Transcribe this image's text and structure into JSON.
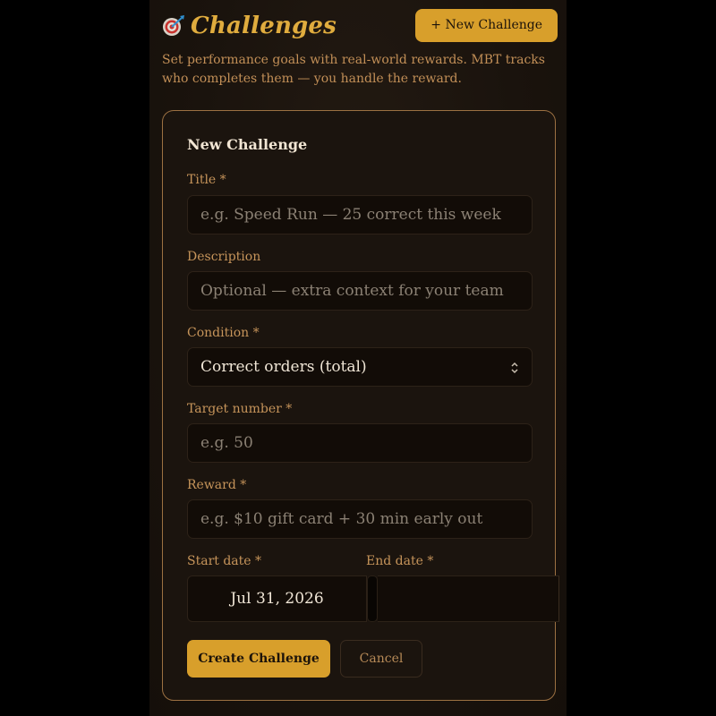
{
  "header": {
    "title": "Challenges",
    "icon": "target-dart-icon",
    "new_button_label": "+ New Challenge"
  },
  "subtitle": "Set performance goals with real-world rewards. MBT tracks who completes them — you handle the reward.",
  "form": {
    "heading": "New Challenge",
    "title_field": {
      "label": "Title *",
      "placeholder": "e.g. Speed Run — 25 correct this week",
      "value": ""
    },
    "description_field": {
      "label": "Description",
      "placeholder": "Optional — extra context for your team",
      "value": ""
    },
    "condition_field": {
      "label": "Condition *",
      "selected": "Correct orders (total)"
    },
    "target_field": {
      "label": "Target number *",
      "placeholder": "e.g. 50",
      "value": ""
    },
    "reward_field": {
      "label": "Reward *",
      "placeholder": "e.g. $10 gift card + 30 min early out",
      "value": ""
    },
    "start_date": {
      "label": "Start date *",
      "value": "Jul 31, 2026"
    },
    "end_date": {
      "label": "End date *",
      "value": ""
    },
    "create_label": "Create Challenge",
    "cancel_label": "Cancel"
  },
  "colors": {
    "accent": "#d89f2b",
    "title_gold": "#e0ac3e",
    "label_tan": "#c6945a",
    "card_border": "#9c7142",
    "background": "#1b140e"
  }
}
